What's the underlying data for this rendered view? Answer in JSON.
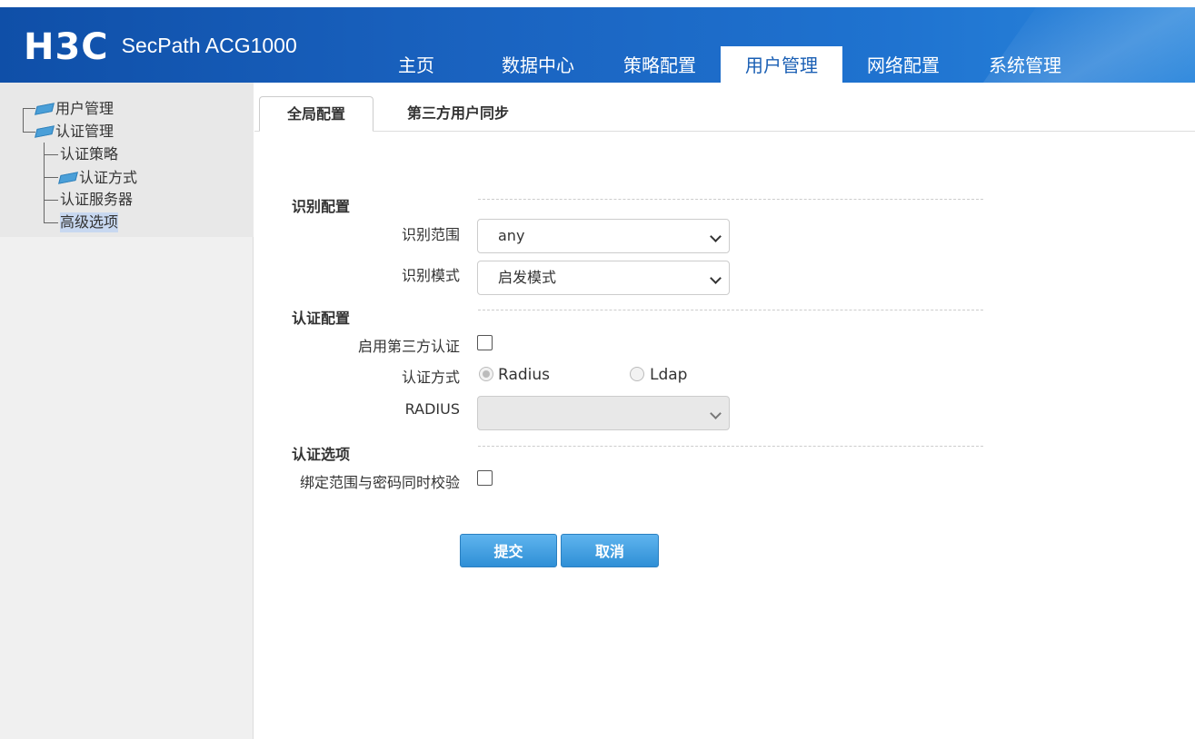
{
  "header": {
    "brand": "H3C",
    "product": "SecPath ACG1000",
    "nav": [
      "主页",
      "数据中心",
      "策略配置",
      "用户管理",
      "网络配置",
      "系统管理"
    ],
    "active_nav": "用户管理"
  },
  "sidebar": {
    "tree": [
      {
        "label": "用户管理",
        "folder": true
      },
      {
        "label": "认证管理",
        "folder": true
      },
      {
        "label": "认证策略",
        "folder": false
      },
      {
        "label": "认证方式",
        "folder": true
      },
      {
        "label": "认证服务器",
        "folder": false
      },
      {
        "label": "高级选项",
        "folder": false,
        "selected": true
      }
    ]
  },
  "tabs": [
    "全局配置",
    "第三方用户同步"
  ],
  "form": {
    "identify_section": "识别配置",
    "identify_scope_label": "识别范围",
    "identify_scope_value": "any",
    "identify_mode_label": "识别模式",
    "identify_mode_value": "启发模式",
    "auth_section": "认证配置",
    "enable_third_party_label": "启用第三方认证",
    "auth_method_label": "认证方式",
    "auth_method_options": [
      "Radius",
      "Ldap"
    ],
    "radius_label": "RADIUS",
    "radius_value": "",
    "auth_options_section": "认证选项",
    "bind_check_label": "绑定范围与密码同时校验"
  },
  "buttons": {
    "submit": "提交",
    "cancel": "取消"
  },
  "colors": {
    "header_blue": "#1a63c0",
    "active_nav_text": "#1a5fb4",
    "button_blue": "#2f8fd6"
  }
}
